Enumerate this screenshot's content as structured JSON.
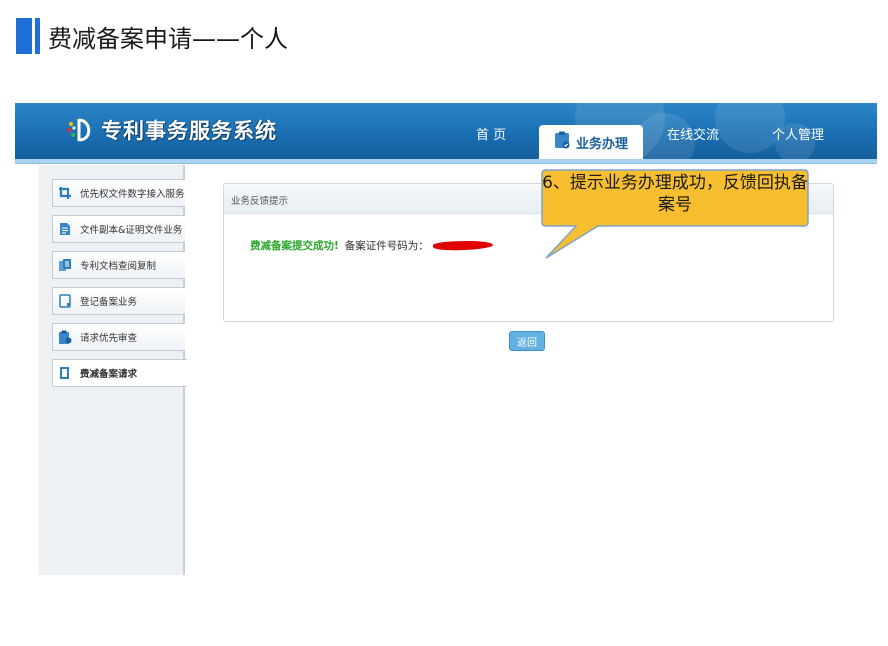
{
  "slide": {
    "title": "费减备案申请——个人"
  },
  "app": {
    "logo_text": "专利事务服务系统",
    "nav": {
      "home": "首 页",
      "business": "业务办理",
      "online": "在线交流",
      "personal": "个人管理"
    }
  },
  "sidebar": {
    "items": [
      {
        "label": "优先权文件数字接入服务",
        "icon": "link-icon"
      },
      {
        "label": "文件副本&证明文件业务",
        "icon": "document-icon"
      },
      {
        "label": "专利文档查阅复制",
        "icon": "copy-document-icon"
      },
      {
        "label": "登记备案业务",
        "icon": "clipboard-icon"
      },
      {
        "label": "请求优先审查",
        "icon": "clipboard-check-icon"
      },
      {
        "label": "费减备案请求",
        "icon": "file-icon"
      }
    ]
  },
  "panel": {
    "header": "业务反馈提示",
    "success_text": "费减备案提交成功!",
    "cert_label": "备案证件号码为："
  },
  "back_button": "返回",
  "callout": {
    "text": "6、提示业务办理成功，反馈回执备案号"
  },
  "colors": {
    "accent": "#1f6fd6",
    "topbar": "#1a6fb3",
    "success": "#2aa82a",
    "callout": "#f7be2f"
  }
}
